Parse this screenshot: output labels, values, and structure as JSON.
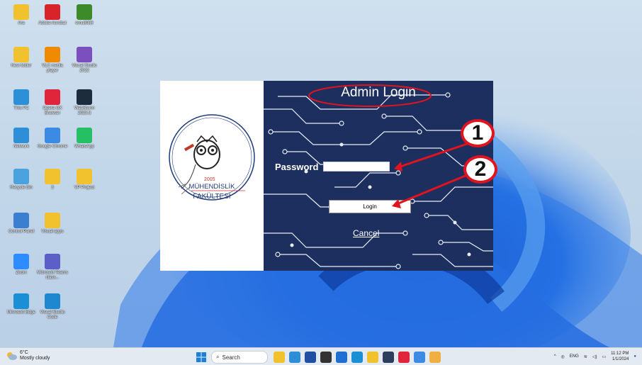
{
  "desktop": {
    "icons": [
      {
        "label": "Ara",
        "icon": "user-folder-icon",
        "color": "#f2c12e"
      },
      {
        "label": "Adobe Acrobat",
        "icon": "acrobat-icon",
        "color": "#d8232a"
      },
      {
        "label": "emu8086",
        "icon": "emu8086-icon",
        "color": "#3d8a2a"
      },
      {
        "label": "New folder",
        "icon": "folder-icon",
        "color": "#f2c12e"
      },
      {
        "label": "VLC media player",
        "icon": "vlc-icon",
        "color": "#f08a00"
      },
      {
        "label": "Visual Studio 2022",
        "icon": "visual-studio-icon",
        "color": "#7b4fbd"
      },
      {
        "label": "This PC",
        "icon": "monitor-icon",
        "color": "#2d8fd8"
      },
      {
        "label": "Opera GX Browser",
        "icon": "opera-gx-icon",
        "color": "#e0243a"
      },
      {
        "label": "WebStorm 2023.3",
        "icon": "webstorm-icon",
        "color": "#1c2c3c"
      },
      {
        "label": "Network",
        "icon": "network-icon",
        "color": "#2d8fd8"
      },
      {
        "label": "Google Chrome",
        "icon": "chrome-icon",
        "color": "#3b8ae3"
      },
      {
        "label": "WhatsApp",
        "icon": "whatsapp-icon",
        "color": "#25c063"
      },
      {
        "label": "Recycle Bin",
        "icon": "recycle-bin-icon",
        "color": "#4aa3df"
      },
      {
        "label": "3",
        "icon": "folder-icon",
        "color": "#f2c12e"
      },
      {
        "label": "VP Project",
        "icon": "folder-icon",
        "color": "#f2c12e"
      },
      {
        "label": "Control Panel",
        "icon": "control-panel-icon",
        "color": "#3b7fd0"
      },
      {
        "label": "Visual apps",
        "icon": "folder-icon",
        "color": "#f2c12e"
      },
      {
        "label": "Zoom",
        "icon": "zoom-icon",
        "color": "#2d8cff"
      },
      {
        "label": "Microsoft Teams class...",
        "icon": "teams-icon",
        "color": "#5b5fc7"
      },
      {
        "label": "Microsoft Edge",
        "icon": "edge-icon",
        "color": "#1a8fd6"
      },
      {
        "label": "Visual Studio Code",
        "icon": "vscode-icon",
        "color": "#1f86d0"
      }
    ]
  },
  "dialog": {
    "title": "Admin Login",
    "password_label": "Password",
    "password_value": "",
    "login_label": "Login",
    "cancel_label": "Cancel",
    "logo": {
      "year": "2005",
      "line1": "MÜHENDİSLİK",
      "line2": "FAKÜLTESİ"
    }
  },
  "annotations": {
    "badge1": "1",
    "badge2": "2",
    "color": "#e0141e"
  },
  "taskbar": {
    "weather_temp": "6°C",
    "weather_desc": "Mostly cloudy",
    "search_label": "Search",
    "apps": [
      "file-explorer-icon",
      "widgets-icon",
      "store-icon",
      "dark-app-icon",
      "chat-icon",
      "edge-icon",
      "folder-icon",
      "calculator-icon",
      "opera-gx-icon",
      "chrome-icon",
      "notes-icon"
    ],
    "lang": "ENG",
    "time": "11:12 PM",
    "date": "1/1/2024"
  }
}
